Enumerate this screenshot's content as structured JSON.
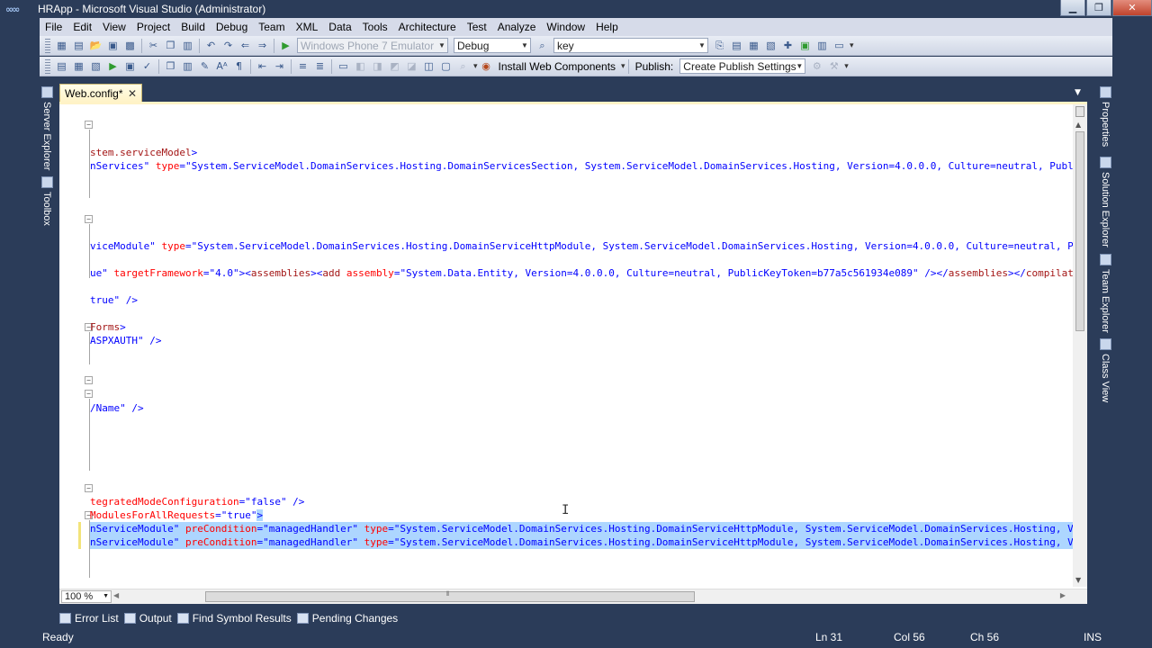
{
  "window": {
    "title": "HRApp - Microsoft Visual Studio (Administrator)"
  },
  "menu": [
    "File",
    "Edit",
    "View",
    "Project",
    "Build",
    "Debug",
    "Team",
    "XML",
    "Data",
    "Tools",
    "Architecture",
    "Test",
    "Analyze",
    "Window",
    "Help"
  ],
  "toolbar": {
    "target_device": "Windows Phone 7 Emulator",
    "configuration": "Debug",
    "find_value": "key",
    "install_web_components": "Install Web Components",
    "publish_label": "Publish:",
    "publish_profile": "Create Publish Settings"
  },
  "side_left": {
    "server_explorer": "Server Explorer",
    "toolbox": "Toolbox"
  },
  "side_right": {
    "properties": "Properties",
    "solution_explorer": "Solution Explorer",
    "team_explorer": "Team Explorer",
    "class_view": "Class View"
  },
  "document": {
    "tab_title": "Web.config*",
    "close_glyph": "✕"
  },
  "code": {
    "line1": {
      "el": "stem.serviceModel",
      "close": ">"
    },
    "line2": {
      "val": "nServices\"",
      "at1": "type",
      "val1": "\"System.ServiceModel.DomainServices.Hosting.DomainServicesSection, System.ServiceModel.DomainServices.Hosting, Version=4.0.0.0, Culture=neutral, PublicK"
    },
    "line3": {
      "val": "viceModule\"",
      "at1": "type",
      "val1": "\"System.ServiceModel.DomainServices.Hosting.DomainServiceHttpModule, System.ServiceModel.DomainServices.Hosting, Version=4.0.0.0, Culture=neutral, Pub"
    },
    "line4": {
      "val": "ue\"",
      "at1": "targetFramework",
      "val1": "\"4.0\"",
      "el1": "assemblies",
      "el2": "add",
      "at2": "assembly",
      "val2": "\"System.Data.Entity, Version=4.0.0.0, Culture=neutral, PublicKeyToken=b77a5c561934e089\"",
      "el3": "assemblies",
      "el4": "compilation"
    },
    "line5": {
      "val": "true\"",
      "close": " />"
    },
    "line6": {
      "el": "Forms",
      "close": ">"
    },
    "line7": {
      "val": "ASPXAUTH\"",
      "close": " />"
    },
    "line8": {
      "val": "/Name\"",
      "close": " />"
    },
    "line9": {
      "at": "tegratedModeConfiguration",
      "val": "\"false\"",
      "close": " />"
    },
    "line10": {
      "at": "ModulesForAllRequests",
      "val": "\"true\"",
      "close": ">"
    },
    "line11": {
      "val": "nServiceModule\"",
      "at1": "preCondition",
      "val1": "\"managedHandler\"",
      "at2": "type",
      "val2": "\"System.ServiceModel.DomainServices.Hosting.DomainServiceHttpModule, System.ServiceModel.DomainServices.Hosting, Vers"
    },
    "line12": {
      "val": "nServiceModule\"",
      "at1": "preCondition",
      "val1": "\"managedHandler\"",
      "at2": "type",
      "val2": "\"System.ServiceModel.DomainServices.Hosting.DomainServiceHttpModule, System.ServiceModel.DomainServices.Hosting, Vers"
    }
  },
  "editor": {
    "zoom": "100 %"
  },
  "bottom_tabs": [
    "Error List",
    "Output",
    "Find Symbol Results",
    "Pending Changes"
  ],
  "status": {
    "state": "Ready",
    "ln": "Ln 31",
    "col": "Col 56",
    "ch": "Ch 56",
    "mode": "INS"
  },
  "colors": {
    "chrome": "#2b3c59",
    "menu": "#d6dbe9",
    "selection": "#add6ff",
    "tab_active": "#fff3c7"
  }
}
